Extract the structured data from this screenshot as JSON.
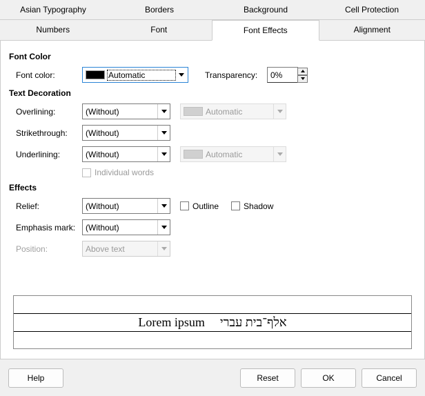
{
  "tabs_row1": [
    "Asian Typography",
    "Borders",
    "Background",
    "Cell Protection"
  ],
  "tabs_row2": [
    "Numbers",
    "Font",
    "Font Effects",
    "Alignment"
  ],
  "active_tab": "Font Effects",
  "sections": {
    "font_color": {
      "title": "Font Color",
      "label": "Font color:",
      "value": "Automatic",
      "transparency_label": "Transparency:",
      "transparency_value": "0%"
    },
    "text_decoration": {
      "title": "Text Decoration",
      "overlining_label": "Overlining:",
      "overlining_value": "(Without)",
      "overlining_color": "Automatic",
      "strike_label": "Strikethrough:",
      "strike_value": "(Without)",
      "underlining_label": "Underlining:",
      "underlining_value": "(Without)",
      "underlining_color": "Automatic",
      "individual_words_label": "Individual words"
    },
    "effects": {
      "title": "Effects",
      "relief_label": "Relief:",
      "relief_value": "(Without)",
      "outline_label": "Outline",
      "shadow_label": "Shadow",
      "emphasis_label": "Emphasis mark:",
      "emphasis_value": "(Without)",
      "position_label": "Position:",
      "position_value": "Above text"
    }
  },
  "preview": {
    "latin": "Lorem ipsum",
    "hebrew": "אלף־בית עברי"
  },
  "buttons": {
    "help": "Help",
    "reset": "Reset",
    "ok": "OK",
    "cancel": "Cancel"
  }
}
